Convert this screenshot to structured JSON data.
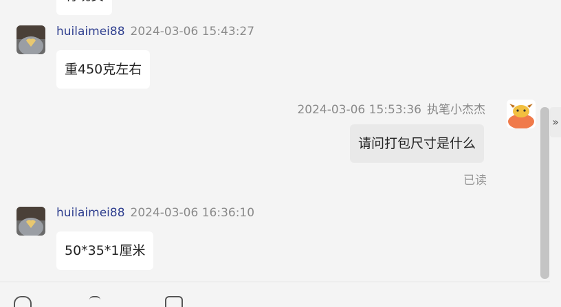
{
  "messages": [
    {
      "type": "partial",
      "text": "有现货"
    },
    {
      "type": "received",
      "username": "huilaimei88",
      "time": "2024-03-06 15:43:27",
      "text": "重450克左右"
    },
    {
      "type": "sent",
      "username": "执笔小杰杰",
      "time": "2024-03-06 15:53:36",
      "text": "请问打包尺寸是什么",
      "status": "已读"
    },
    {
      "type": "received",
      "username": "huilaimei88",
      "time": "2024-03-06 16:36:10",
      "text": "50*35*1厘米"
    }
  ],
  "side_tab": {
    "icon": "double-chevron-right-icon",
    "glyph": "»"
  },
  "colors": {
    "username": "#2f3f8f",
    "timestamp": "#8a8a8a",
    "background": "#f4f4f4",
    "bubble": "#ffffff",
    "bubble_mine": "#e9e9e9"
  }
}
